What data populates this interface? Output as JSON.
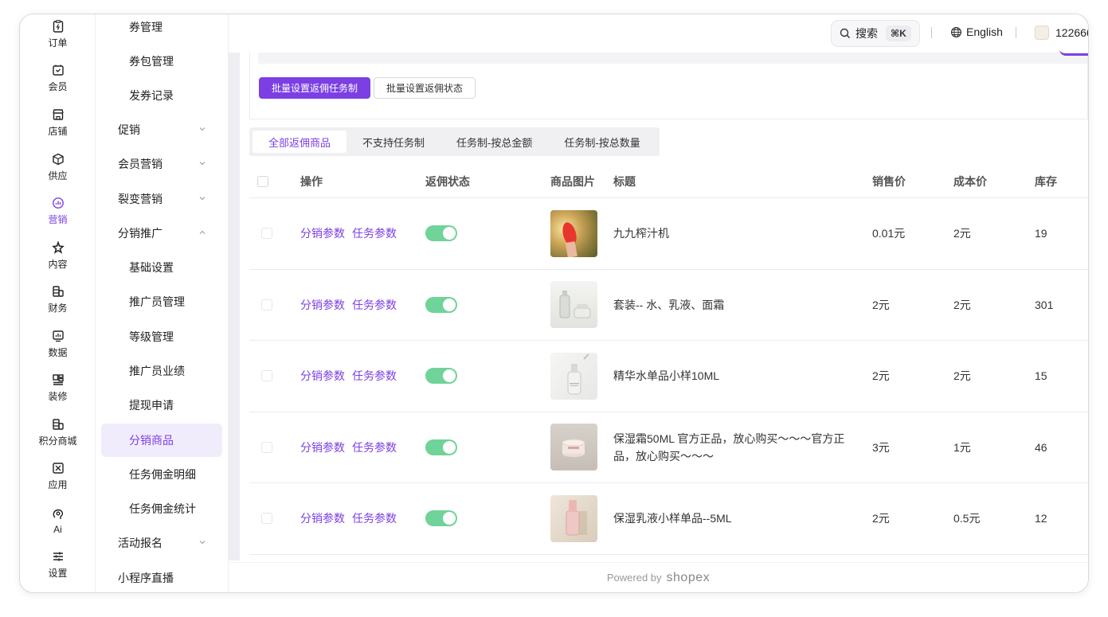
{
  "rail": [
    {
      "icon": "order-icon",
      "label": "订单"
    },
    {
      "icon": "member-icon",
      "label": "会员"
    },
    {
      "icon": "store-icon",
      "label": "店铺"
    },
    {
      "icon": "supply-icon",
      "label": "供应"
    },
    {
      "icon": "marketing-icon",
      "label": "营销",
      "active": true
    },
    {
      "icon": "content-icon",
      "label": "内容"
    },
    {
      "icon": "finance-icon",
      "label": "财务"
    },
    {
      "icon": "data-icon",
      "label": "数据"
    },
    {
      "icon": "decorate-icon",
      "label": "装修"
    },
    {
      "icon": "points-mall-icon",
      "label": "积分商城"
    },
    {
      "icon": "apps-icon",
      "label": "应用"
    },
    {
      "icon": "ai-icon",
      "label": "Ai"
    },
    {
      "icon": "settings-icon",
      "label": "设置"
    }
  ],
  "submenu": [
    {
      "label": "券管理",
      "level": 2
    },
    {
      "label": "券包管理",
      "level": 2
    },
    {
      "label": "发券记录",
      "level": 2
    },
    {
      "label": "促销",
      "level": 1,
      "chevron": "down"
    },
    {
      "label": "会员营销",
      "level": 1,
      "chevron": "down"
    },
    {
      "label": "裂变营销",
      "level": 1,
      "chevron": "down"
    },
    {
      "label": "分销推广",
      "level": 1,
      "chevron": "up"
    },
    {
      "label": "基础设置",
      "level": 2
    },
    {
      "label": "推广员管理",
      "level": 2
    },
    {
      "label": "等级管理",
      "level": 2
    },
    {
      "label": "推广员业绩",
      "level": 2
    },
    {
      "label": "提现申请",
      "level": 2
    },
    {
      "label": "分销商品",
      "level": 2,
      "active": true
    },
    {
      "label": "任务佣金明细",
      "level": 2
    },
    {
      "label": "任务佣金统计",
      "level": 2
    },
    {
      "label": "活动报名",
      "level": 1,
      "chevron": "down"
    },
    {
      "label": "小程序直播",
      "level": 1
    }
  ],
  "topbar": {
    "search_label": "搜索",
    "search_shortcut": "⌘K",
    "language": "English",
    "account": "122666"
  },
  "actions": {
    "batch_task_label": "批量设置返佣任务制",
    "batch_status_label": "批量设置返佣状态"
  },
  "tabs": [
    {
      "label": "全部返佣商品",
      "active": true
    },
    {
      "label": "不支持任务制"
    },
    {
      "label": "任务制-按总金额"
    },
    {
      "label": "任务制-按总数量"
    }
  ],
  "table": {
    "headers": {
      "ops": "操作",
      "status": "返佣状态",
      "image": "商品图片",
      "title": "标题",
      "price": "销售价",
      "cost": "成本价",
      "stock": "库存"
    },
    "link_distribution": "分销参数",
    "link_task": "任务参数",
    "rows": [
      {
        "title": "九九榨汁机",
        "price": "0.01元",
        "cost": "2元",
        "stock": "19",
        "enabled": true,
        "thumb": "juicer"
      },
      {
        "title": "套装-- 水、乳液、面霜",
        "price": "2元",
        "cost": "2元",
        "stock": "301",
        "enabled": true,
        "thumb": "set"
      },
      {
        "title": "精华水单品小样10ML",
        "price": "2元",
        "cost": "2元",
        "stock": "15",
        "enabled": true,
        "thumb": "essence"
      },
      {
        "title": "保湿霜50ML 官方正品，放心购买～～～官方正品，放心购买～～～",
        "price": "3元",
        "cost": "1元",
        "stock": "46",
        "enabled": true,
        "thumb": "cream"
      },
      {
        "title": "保湿乳液小样单品--5ML",
        "price": "2元",
        "cost": "0.5元",
        "stock": "12",
        "enabled": true,
        "thumb": "lotion"
      }
    ]
  },
  "footer": {
    "powered_by": "Powered by",
    "brand": "shopex"
  },
  "colors": {
    "accent": "#7b3fe4",
    "toggle_on": "#6fd39a"
  }
}
